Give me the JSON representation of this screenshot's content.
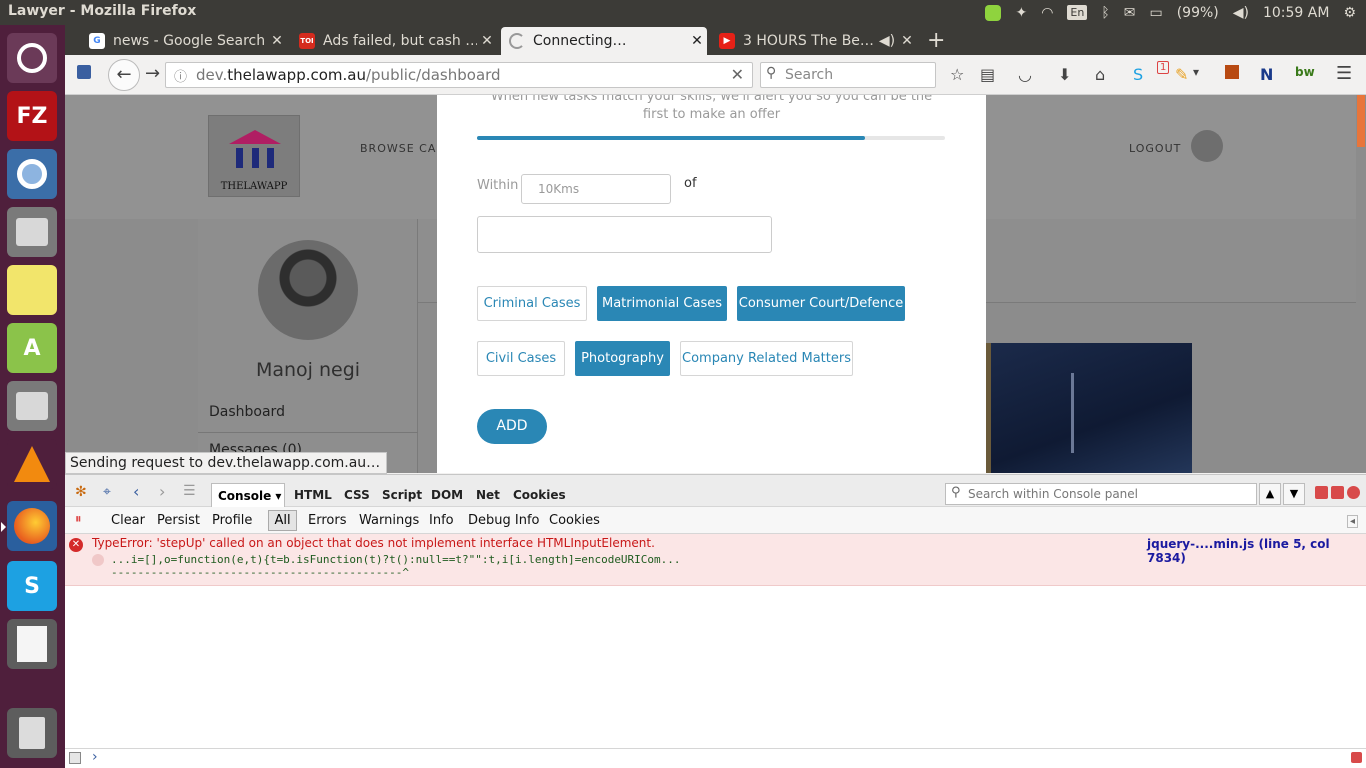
{
  "system": {
    "window_title": "Lawyer - Mozilla Firefox",
    "battery": "(99%)",
    "clock": "10:59 AM",
    "language": "En",
    "launcher_items": [
      "Ubuntu Dash",
      "FileZilla",
      "Chromium",
      "Files",
      "Sticky Notes",
      "Android Studio",
      "Files",
      "VLC",
      "Firefox",
      "Skype",
      "Text Editor",
      "Trash"
    ]
  },
  "browser": {
    "tabs": [
      {
        "title": "news - Google Search",
        "favicon": "G"
      },
      {
        "title": "Ads failed, but cash …",
        "favicon": "TOI"
      },
      {
        "title": "Connecting…",
        "favicon": ""
      },
      {
        "title": "3 HOURS The Be…",
        "favicon": "▶"
      }
    ],
    "url_host_prefix": "dev.",
    "url_host": "thelawapp.com.au",
    "url_path": "/public/dashboard",
    "search_placeholder": "Search",
    "status_text": "Sending request to dev.thelawapp.com.au…",
    "notification_badge": "1"
  },
  "site": {
    "logo_text": "THELAWAPP",
    "nav_browse": "BROWSE CAS",
    "nav_logout": "LOGOUT",
    "profile_name": "Manoj negi",
    "menu_dashboard": "Dashboard",
    "menu_messages": "Messages (0)"
  },
  "modal": {
    "hint_line1": "When new tasks match your skills, we'll alert you so you can be the",
    "hint_line2": "first to make an offer",
    "progress": 0.83,
    "within_label": "Within",
    "distance_placeholder": "10Kms",
    "of_label": "of",
    "location_value": "",
    "categories": [
      {
        "label": "Criminal Cases",
        "selected": false
      },
      {
        "label": "Matrimonial Cases",
        "selected": true
      },
      {
        "label": "Consumer Court/Defence",
        "selected": true
      },
      {
        "label": "Civil Cases",
        "selected": false
      },
      {
        "label": "Photography",
        "selected": true
      },
      {
        "label": "Company Related Matters",
        "selected": false
      }
    ],
    "add_label": "ADD",
    "accent_color": "#2a87b5"
  },
  "devtools": {
    "tabs": [
      "Console",
      "HTML",
      "CSS",
      "Script",
      "DOM",
      "Net",
      "Cookies"
    ],
    "search_placeholder": "Search within Console panel",
    "filters": [
      "Clear",
      "Persist",
      "Profile",
      "All",
      "Errors",
      "Warnings",
      "Info",
      "Debug Info",
      "Cookies"
    ],
    "error_message": "TypeError: 'stepUp' called on an object that does not implement interface HTMLInputElement.",
    "error_code": "...i=[],o=function(e,t){t=b.isFunction(t)?t():null==t?\"\":t,i[i.length]=encodeURICom...",
    "error_pointer": "--------------------------------------------^",
    "error_source": "jquery-....min.js (line 5, col 7834)",
    "command_prompt": "›"
  }
}
